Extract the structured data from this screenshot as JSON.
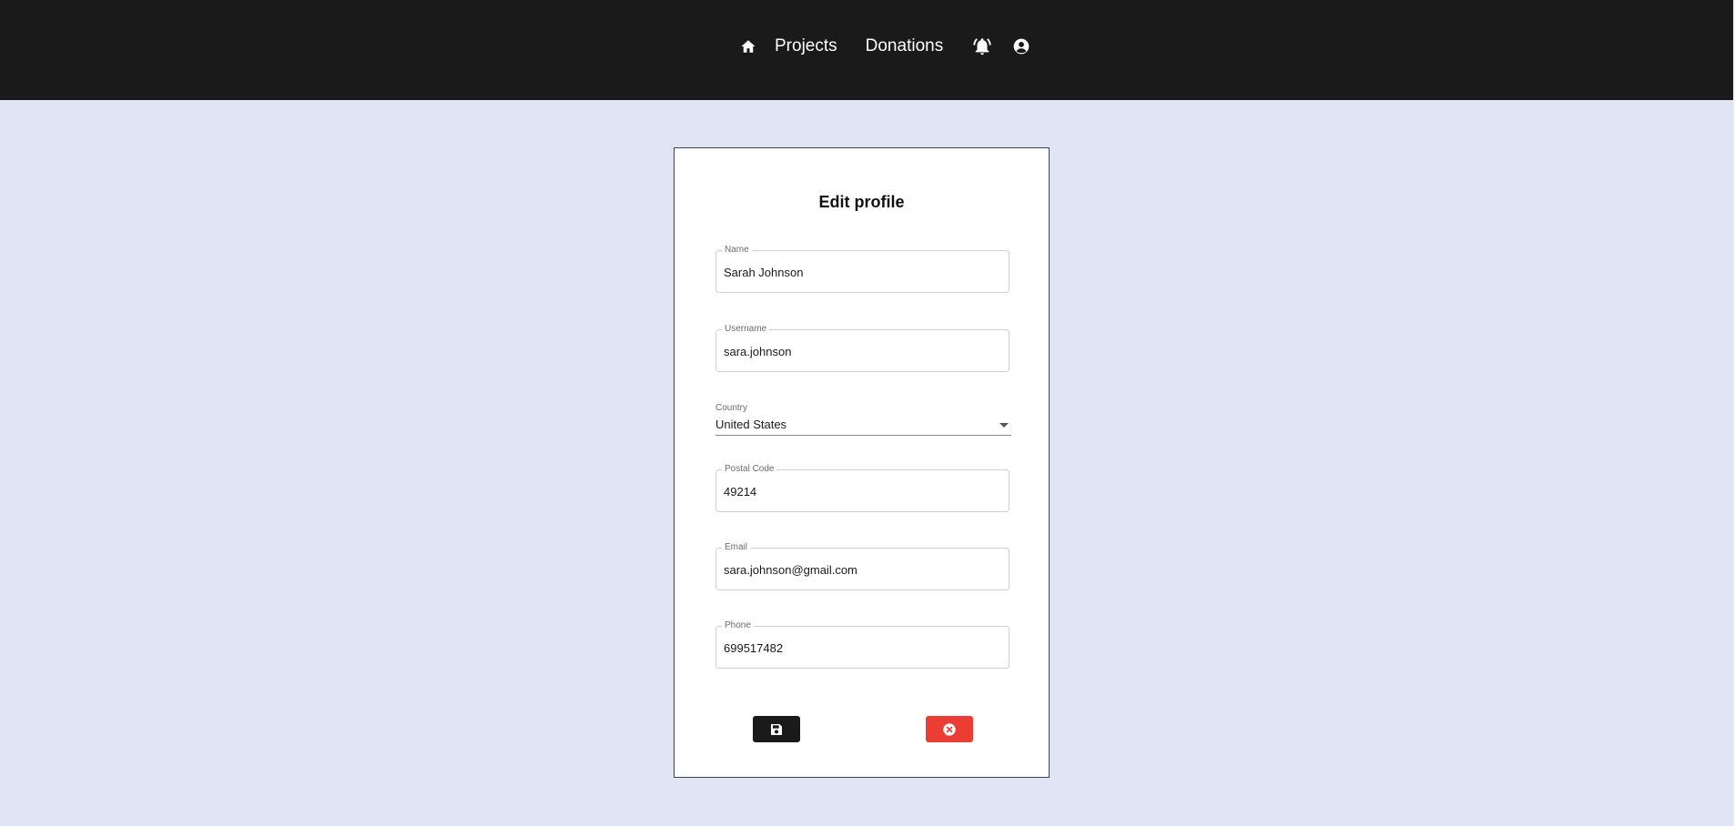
{
  "nav": {
    "home_icon": "home-icon",
    "projects_label": "Projects",
    "donations_label": "Donations",
    "notifications_icon": "bell-ringing-icon",
    "account_icon": "user-circle-icon"
  },
  "form": {
    "title": "Edit profile",
    "fields": [
      {
        "label": "Name",
        "value": "Sarah Johnson"
      },
      {
        "label": "Username",
        "value": "sara.johnson"
      },
      {
        "label": "Postal Code",
        "value": "49214"
      },
      {
        "label": "Email",
        "value": "sara.johnson@gmail.com"
      },
      {
        "label": "Phone",
        "value": "699517482"
      }
    ],
    "country": {
      "label": "Country",
      "value": "United States"
    }
  },
  "actions": {
    "save_icon": "floppy-disk-icon",
    "cancel_icon": "circle-x-icon"
  },
  "colors": {
    "header_bg": "#1a1a1a",
    "page_bg": "#e0e5f5",
    "save_bg": "#1a1a1a",
    "cancel_bg": "#ea3d33"
  }
}
